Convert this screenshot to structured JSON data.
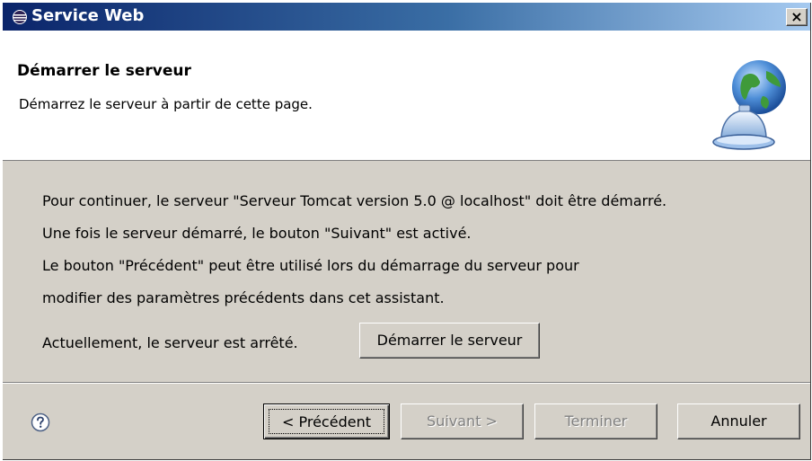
{
  "window": {
    "title": "Service Web",
    "close_glyph": "×"
  },
  "header": {
    "title": "Démarrer le serveur",
    "description": "Démarrez le serveur à partir de cette page.",
    "graphic_icon": "globe-with-service-bell-icon"
  },
  "body": {
    "lines": [
      "Pour continuer, le serveur \"Serveur Tomcat version 5.0 @ localhost\" doit être démarré.",
      "Une fois le serveur démarré, le bouton \"Suivant\" est activé.",
      "Le bouton \"Précédent\" peut être utilisé lors du démarrage du serveur pour",
      "modifier des paramètres précédents dans cet assistant."
    ],
    "status_text": "Actuellement, le serveur est arrêté.",
    "start_button_label": "Démarrer le serveur"
  },
  "footer": {
    "help_icon": "help-question-icon",
    "buttons": {
      "previous": {
        "label": "< Précédent",
        "mnemonic": "P",
        "enabled": true
      },
      "next": {
        "label": "Suivant >",
        "mnemonic": "S",
        "enabled": false
      },
      "finish": {
        "label": "Terminer",
        "mnemonic": "T",
        "enabled": false
      },
      "cancel": {
        "label": "Annuler",
        "enabled": true
      }
    }
  },
  "colors": {
    "titlebar_start": "#0a246a",
    "titlebar_end": "#a6caf0",
    "dialog_bg": "#d4d0c8",
    "disabled_text": "#808080"
  }
}
